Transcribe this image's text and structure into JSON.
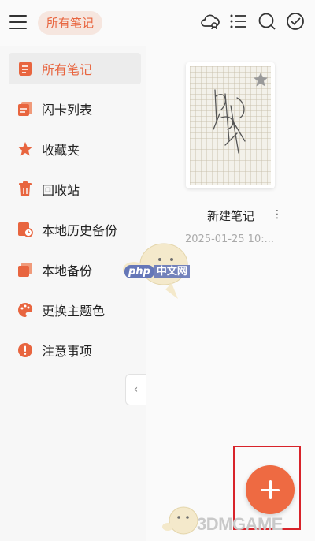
{
  "header": {
    "title": "所有笔记",
    "icons": [
      "cloud-sync-icon",
      "list-icon",
      "search-icon",
      "check-circle-icon"
    ]
  },
  "sidebar": {
    "items": [
      {
        "label": "所有笔记",
        "icon": "notes-icon",
        "active": true
      },
      {
        "label": "闪卡列表",
        "icon": "flashcard-icon"
      },
      {
        "label": "收藏夹",
        "icon": "star-icon"
      },
      {
        "label": "回收站",
        "icon": "trash-icon"
      },
      {
        "label": "本地历史备份",
        "icon": "history-backup-icon"
      },
      {
        "label": "本地备份",
        "icon": "backup-icon"
      },
      {
        "label": "更换主题色",
        "icon": "palette-icon"
      },
      {
        "label": "注意事项",
        "icon": "alert-icon"
      }
    ],
    "collapse_glyph": "‹"
  },
  "notes": [
    {
      "title": "新建笔记",
      "date": "2025-01-25 10:...",
      "favorited": true
    }
  ],
  "watermarks": {
    "php": "php",
    "cn": "中文网",
    "brand": "3DMGAME"
  },
  "colors": {
    "accent": "#e8653f",
    "fab": "#ee6a42",
    "highlight_frame": "#d8232a"
  }
}
